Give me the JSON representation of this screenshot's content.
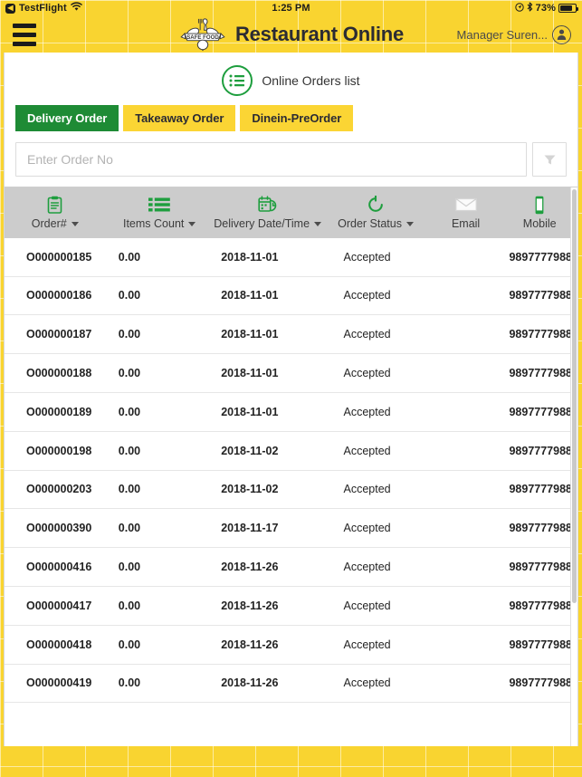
{
  "status_bar": {
    "back_label": "TestFlight",
    "back_icon": "chevron-left-icon",
    "wifi_icon": "wifi-icon",
    "time": "1:25 PM",
    "location_icon": "location-icon",
    "bluetooth_icon": "bluetooth-icon",
    "battery_percent": "73%",
    "battery_icon": "battery-icon"
  },
  "header": {
    "menu_icon": "hamburger-menu-icon",
    "logo_icon": "safe-food-badge-logo",
    "logo_text": "SAFE FOOD",
    "title": "Restaurant Online",
    "user_name": "Manager Suren...",
    "user_icon": "user-avatar-icon",
    "background_color": "#f9d430"
  },
  "orders_panel": {
    "list_icon": "bulleted-list-icon",
    "heading": "Online Orders list",
    "accent_green": "#1e8b35",
    "tabs": [
      {
        "label": "Delivery Order",
        "active": true
      },
      {
        "label": "Takeaway Order",
        "active": false
      },
      {
        "label": "Dinein-PreOrder",
        "active": false
      }
    ],
    "search": {
      "placeholder": "Enter Order No",
      "value": "",
      "filter_icon": "funnel-filter-icon"
    }
  },
  "table": {
    "columns": [
      {
        "label": "Order#",
        "icon": "clipboard-icon",
        "sortable": true
      },
      {
        "label": "Items Count",
        "icon": "list-lines-icon",
        "sortable": true
      },
      {
        "label": "Delivery Date/Time",
        "icon": "calendar-clock-icon",
        "sortable": true
      },
      {
        "label": "Order Status",
        "icon": "refresh-circle-icon",
        "sortable": true
      },
      {
        "label": "Email",
        "icon": "envelope-icon",
        "sortable": false
      },
      {
        "label": "Mobile",
        "icon": "mobile-phone-icon",
        "sortable": false
      }
    ],
    "rows": [
      {
        "order": "O000000185",
        "items": "0.00",
        "date": "2018-11-01",
        "status": "Accepted",
        "email": "",
        "mobile": "9897777988"
      },
      {
        "order": "O000000186",
        "items": "0.00",
        "date": "2018-11-01",
        "status": "Accepted",
        "email": "",
        "mobile": "9897777988"
      },
      {
        "order": "O000000187",
        "items": "0.00",
        "date": "2018-11-01",
        "status": "Accepted",
        "email": "",
        "mobile": "9897777988"
      },
      {
        "order": "O000000188",
        "items": "0.00",
        "date": "2018-11-01",
        "status": "Accepted",
        "email": "",
        "mobile": "9897777988"
      },
      {
        "order": "O000000189",
        "items": "0.00",
        "date": "2018-11-01",
        "status": "Accepted",
        "email": "",
        "mobile": "9897777988"
      },
      {
        "order": "O000000198",
        "items": "0.00",
        "date": "2018-11-02",
        "status": "Accepted",
        "email": "",
        "mobile": "9897777988"
      },
      {
        "order": "O000000203",
        "items": "0.00",
        "date": "2018-11-02",
        "status": "Accepted",
        "email": "",
        "mobile": "9897777988"
      },
      {
        "order": "O000000390",
        "items": "0.00",
        "date": "2018-11-17",
        "status": "Accepted",
        "email": "",
        "mobile": "9897777988"
      },
      {
        "order": "O000000416",
        "items": "0.00",
        "date": "2018-11-26",
        "status": "Accepted",
        "email": "",
        "mobile": "9897777988"
      },
      {
        "order": "O000000417",
        "items": "0.00",
        "date": "2018-11-26",
        "status": "Accepted",
        "email": "",
        "mobile": "9897777988"
      },
      {
        "order": "O000000418",
        "items": "0.00",
        "date": "2018-11-26",
        "status": "Accepted",
        "email": "",
        "mobile": "9897777988"
      },
      {
        "order": "O000000419",
        "items": "0.00",
        "date": "2018-11-26",
        "status": "Accepted",
        "email": "",
        "mobile": "9897777988"
      }
    ]
  }
}
